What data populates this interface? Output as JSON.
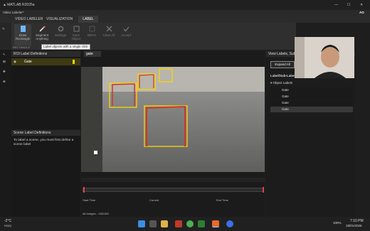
{
  "window": {
    "title": "MATLAB R2025a",
    "app_tab_title": "Video Labeler*",
    "user_badge": "AO"
  },
  "tabs": [
    {
      "label": "VIDEO LABELER"
    },
    {
      "label": "VISUALIZATION"
    },
    {
      "label": "LABEL"
    }
  ],
  "ribbon": {
    "buttons": [
      {
        "label": "Draw Rectangle",
        "icon": "draw-rectangle-icon",
        "enabled": true
      },
      {
        "label": "Segment Anything",
        "icon": "segment-anything-icon",
        "enabled": true
      },
      {
        "label": "Settings",
        "icon": "settings-icon",
        "enabled": false
      },
      {
        "label": "Mark Object",
        "icon": "mark-object-icon",
        "enabled": false
      },
      {
        "label": "BBOX",
        "icon": "bbox-icon",
        "enabled": false
      },
      {
        "label": "Clear All",
        "icon": "clear-all-icon",
        "enabled": false
      },
      {
        "label": "Accept",
        "icon": "accept-icon",
        "enabled": false
      }
    ],
    "section_label": "RECTANGLE",
    "tooltip": "Label objects with a single click"
  },
  "roi_panel": {
    "title": "ROI Label Definitions",
    "items": [
      {
        "label": "Gate",
        "color": "#ffd400"
      }
    ]
  },
  "scene_panel": {
    "title": "Scene Label Definitions",
    "message": "To label a scene, you must first define a scene label"
  },
  "video": {
    "tab_label": "gate",
    "time_labels": {
      "start": "Start Time",
      "current": "Current",
      "end": "End Time"
    },
    "status": "All Images - 183/183"
  },
  "right_panel": {
    "title": "View Labels, Sub",
    "expand_button": "Expand All",
    "tree_header": "Label/Sub-Label",
    "group": "Object Labels",
    "rows": [
      "Gate",
      "Gate",
      "Gate",
      "Gate"
    ]
  },
  "taskbar": {
    "weather_temp": "-2°C",
    "weather_text": "Hazy",
    "battery": "100%",
    "time": "7:10 PM",
    "date": "18/01/2026"
  }
}
